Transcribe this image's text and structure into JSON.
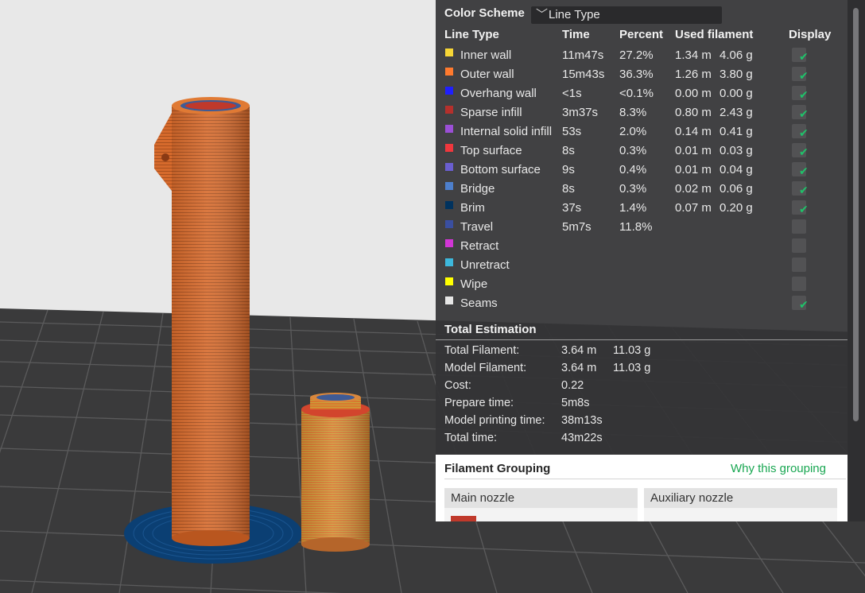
{
  "color_scheme": {
    "label": "Color Scheme",
    "selected": "Line Type"
  },
  "legend_header": {
    "line_type": "Line Type",
    "time": "Time",
    "percent": "Percent",
    "used_filament": "Used filament",
    "display": "Display"
  },
  "line_types": [
    {
      "name": "Inner wall",
      "time": "11m47s",
      "percent": "27.2%",
      "length": "1.34 m",
      "weight": "4.06 g",
      "color": "#f7d636",
      "display": true
    },
    {
      "name": "Outer wall",
      "time": "15m43s",
      "percent": "36.3%",
      "length": "1.26 m",
      "weight": "3.80 g",
      "color": "#ff7a2e",
      "display": true
    },
    {
      "name": "Overhang wall",
      "time": "<1s",
      "percent": "<0.1%",
      "length": "0.00 m",
      "weight": "0.00 g",
      "color": "#1f1fff",
      "display": true
    },
    {
      "name": "Sparse infill",
      "time": "3m37s",
      "percent": "8.3%",
      "length": "0.80 m",
      "weight": "2.43 g",
      "color": "#b5302c",
      "display": true
    },
    {
      "name": "Internal solid infill",
      "time": "53s",
      "percent": "2.0%",
      "length": "0.14 m",
      "weight": "0.41 g",
      "color": "#9b4fd6",
      "display": true
    },
    {
      "name": "Top surface",
      "time": "8s",
      "percent": "0.3%",
      "length": "0.01 m",
      "weight": "0.03 g",
      "color": "#f0373d",
      "display": true
    },
    {
      "name": "Bottom surface",
      "time": "9s",
      "percent": "0.4%",
      "length": "0.01 m",
      "weight": "0.04 g",
      "color": "#6a5ed0",
      "display": true
    },
    {
      "name": "Bridge",
      "time": "8s",
      "percent": "0.3%",
      "length": "0.02 m",
      "weight": "0.06 g",
      "color": "#4d7fcc",
      "display": true
    },
    {
      "name": "Brim",
      "time": "37s",
      "percent": "1.4%",
      "length": "0.07 m",
      "weight": "0.20 g",
      "color": "#00325e",
      "display": true
    },
    {
      "name": "Travel",
      "time": "5m7s",
      "percent": "11.8%",
      "length": "",
      "weight": "",
      "color": "#3a4fa0",
      "display": false
    },
    {
      "name": "Retract",
      "time": "",
      "percent": "",
      "length": "",
      "weight": "",
      "color": "#d236d6",
      "display": false
    },
    {
      "name": "Unretract",
      "time": "",
      "percent": "",
      "length": "",
      "weight": "",
      "color": "#3db8dc",
      "display": false
    },
    {
      "name": "Wipe",
      "time": "",
      "percent": "",
      "length": "",
      "weight": "",
      "color": "#ffff00",
      "display": false
    },
    {
      "name": "Seams",
      "time": "",
      "percent": "",
      "length": "",
      "weight": "",
      "color": "#e6e6e6",
      "display": true
    }
  ],
  "total_estimation": {
    "title": "Total Estimation",
    "rows": [
      {
        "label": "Total Filament:",
        "v1": "3.64 m",
        "v2": "11.03 g"
      },
      {
        "label": "Model Filament:",
        "v1": "3.64 m",
        "v2": "11.03 g"
      },
      {
        "label": "Cost:",
        "v1": "0.22",
        "v2": ""
      },
      {
        "label": "Prepare time:",
        "v1": "5m8s",
        "v2": ""
      },
      {
        "label": "Model printing time:",
        "v1": "38m13s",
        "v2": ""
      },
      {
        "label": "Total time:",
        "v1": "43m22s",
        "v2": ""
      }
    ]
  },
  "filament_grouping": {
    "title": "Filament Grouping",
    "link": "Why this grouping",
    "main_nozzle": "Main nozzle",
    "aux_nozzle": "Auxiliary nozzle",
    "filament_color": "#c0392b"
  },
  "theme": {
    "check_color": "#1fc36a",
    "link_color": "#19a752",
    "model_orange": "#d96b2b",
    "brim_blue": "#0b3f73"
  }
}
